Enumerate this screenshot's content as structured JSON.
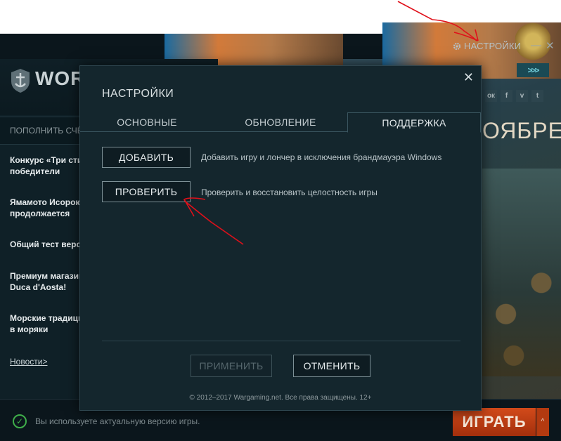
{
  "launcher": {
    "settings_label": "НАСТРОЙКИ",
    "minimize_glyph": "—",
    "close_glyph": "✕",
    "logo_text": "WORL",
    "topup_label": "ПОПОЛНИТЬ СЧЁТ",
    "news": [
      {
        "line1": "Конкурс «Три сти",
        "line2": "победители"
      },
      {
        "line1": "Ямамото Исороку",
        "line2": "продолжается"
      },
      {
        "line1": "Общий тест верси",
        "line2": ""
      },
      {
        "line1": "Премиум магазин",
        "line2": "Duca d'Aosta!"
      },
      {
        "line1": "Морские традиции",
        "line2": "в моряки"
      }
    ],
    "news_link": "Новости>",
    "banner_title": "ОЯБРЕ",
    "arrow_btn": ">>>",
    "social": [
      "ок",
      "f",
      "v",
      "t"
    ],
    "status_text": "Вы используете актуальную версию игры.",
    "play_label": "ИГРАТЬ",
    "play_arrow": "^"
  },
  "dialog": {
    "title": "НАСТРОЙКИ",
    "close_glyph": "✕",
    "tabs": [
      "ОСНОВНЫЕ",
      "ОБНОВЛЕНИЕ",
      "ПОДДЕРЖКА"
    ],
    "active_tab": "ПОДДЕРЖКА",
    "actions": [
      {
        "label": "ДОБАВИТЬ",
        "description": "Добавить игру и лончер в исключения брандмауэра Windows"
      },
      {
        "label": "ПРОВЕРИТЬ",
        "description": "Проверить и восстановить целостность игры"
      }
    ],
    "apply_label": "ПРИМЕНИТЬ",
    "cancel_label": "ОТМЕНИТЬ",
    "copyright": "© 2012–2017 Wargaming.net. Все права защищены. 12+"
  },
  "colors": {
    "annotation": "#e0101a",
    "status_ok": "#3fae4a",
    "play": "#c23e14"
  },
  "icons": {
    "settings": "gear-icon",
    "status": "check-circle-icon"
  }
}
